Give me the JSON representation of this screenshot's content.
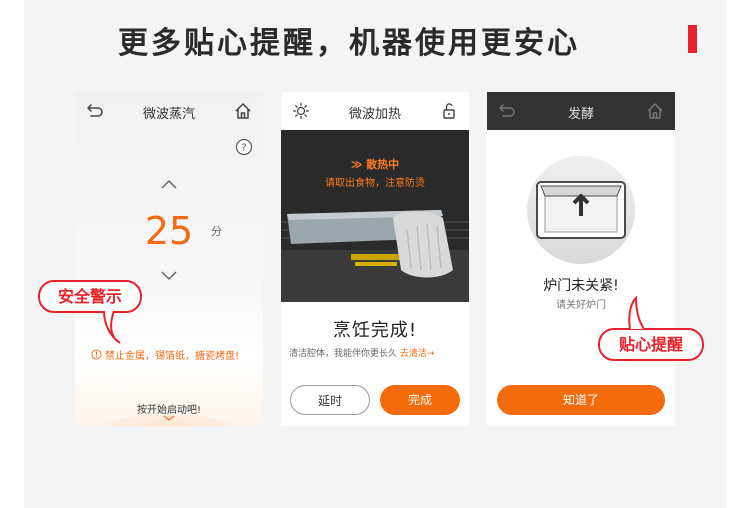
{
  "headline": "更多贴心提醒，机器使用更安心",
  "colors": {
    "accent": "#f46b0c",
    "callout": "#e8222a",
    "text": "#2a2a2a"
  },
  "phones": [
    {
      "title": "微波蒸汽",
      "left_icon": "back-arrow-icon",
      "right_icon": "home-icon",
      "help_icon": "question-icon",
      "time_value": "25",
      "time_unit": "分",
      "warning": "禁止金属，锡箔纸，搪瓷烤盘!",
      "start_hint": "按开始启动吧!"
    },
    {
      "title": "微波加热",
      "left_icon": "light-bulb-icon",
      "right_icon": "unlock-icon",
      "photo_status": "散热中",
      "photo_warning": "请取出食物，注意防烫",
      "done_title": "烹饪完成!",
      "done_sub": "清洁腔体，我能伴你更长久",
      "done_link": "去清洁→",
      "delay_button": "延时",
      "finish_button": "完成"
    },
    {
      "title": "发酵",
      "left_icon": "back-arrow-icon",
      "right_icon": "home-icon",
      "door_title": "炉门未关紧!",
      "door_sub": "请关好炉门",
      "ok_button": "知道了"
    }
  ],
  "callouts": {
    "safety": "安全警示",
    "reminder": "贴心提醒"
  }
}
